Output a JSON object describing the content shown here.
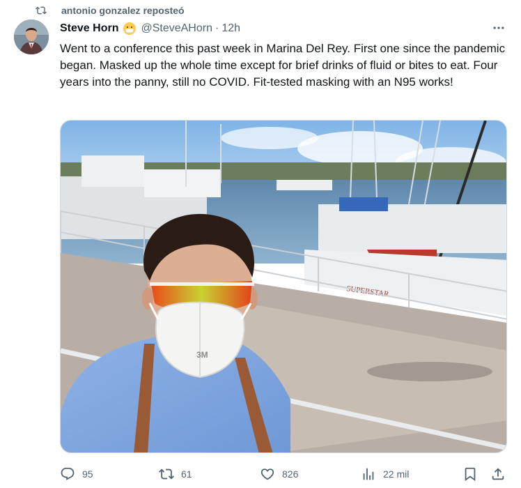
{
  "repost": {
    "text": "antonio gonzalez reposteó",
    "icon": "repost-icon"
  },
  "author": {
    "name": "Steve Horn",
    "emoji": "face-with-medical-mask-emoji",
    "handle": "@SteveAHorn",
    "separator": "·",
    "time": "12h"
  },
  "tweet": {
    "text": "Went to a conference this past week in Marina Del Rey. First one since the pandemic began. Masked up the whole time except for brief drinks of fluid or bites to eat. Four years into the panny, still no COVID. Fit-tested masking with an N95 works!"
  },
  "media": {
    "boat_name": "SUPERSTAR",
    "mask_brand": "3M"
  },
  "actions": {
    "replies": "95",
    "reposts": "61",
    "likes": "826",
    "views": "22 mil"
  },
  "colors": {
    "text_primary": "#0f1419",
    "text_secondary": "#536471",
    "border": "#cfd9de"
  }
}
